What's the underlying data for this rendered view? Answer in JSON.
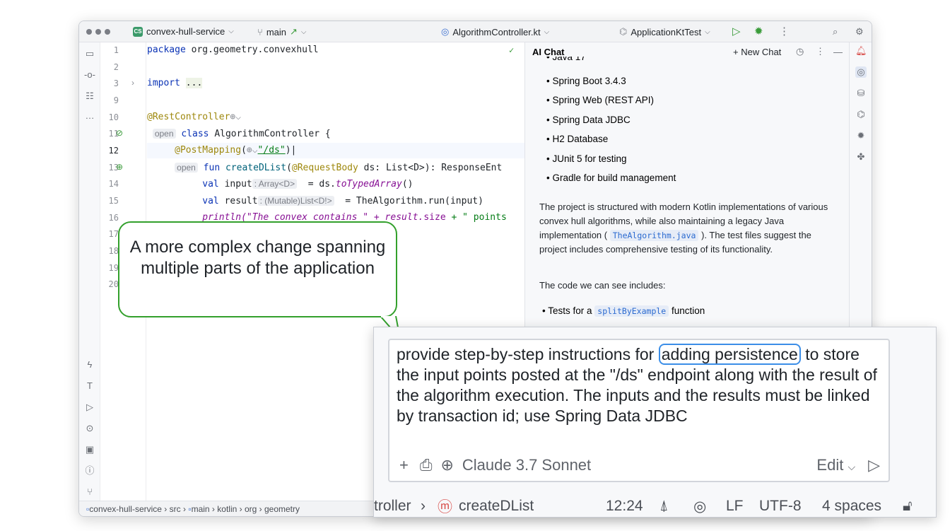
{
  "titlebar": {
    "project": "convex-hull-service",
    "branch": "main",
    "file": "AlgorithmController.kt",
    "run_config": "ApplicationKtTest"
  },
  "editor": {
    "line_numbers": [
      "1",
      "2",
      "3",
      "9",
      "10",
      "11",
      "12",
      "13",
      "14",
      "15",
      "16",
      "17",
      "18",
      "19",
      "20"
    ],
    "package_kw": "package",
    "package_name": "org.geometry.convexhull",
    "import_kw": "import",
    "import_fold": "...",
    "rest_controller": "@RestController",
    "open_hint": "open",
    "class_kw": "class",
    "class_name": "AlgorithmController {",
    "post_mapping": "@PostMapping",
    "post_mapping_path": "\"/ds\"",
    "fun_kw": "fun",
    "fun_name": "createDList",
    "request_body": "@RequestBody",
    "fun_params": "ds: List<D>): ResponseEnt",
    "val_kw": "val",
    "input_var": "input",
    "input_hint": ": Array<D>",
    "input_rhs": "= ds.",
    "to_typed_array": "toTypedArray",
    "parens": "()",
    "result_var": "result",
    "result_hint": ": (Mutable)List<D!>",
    "result_rhs": "= TheAlgorithm.run(input)",
    "println_line": "println(\"The convex contains \" + result.",
    "size_prop": "size",
    "println_tail": "+ \" points"
  },
  "chat": {
    "title": "AI Chat",
    "new_chat": "New Chat",
    "partial_bullet": "Java 17",
    "bullets": [
      "Spring Boot 3.4.3",
      "Spring Web (REST API)",
      "Spring Data JDBC",
      "H2 Database",
      "JUnit 5 for testing",
      "Gradle for build management"
    ],
    "para1_a": "The project is structured with modern Kotlin implementations of various convex hull algorithms, while also maintaining a legacy Java implementation (",
    "para1_code": "TheAlgorithm.java",
    "para1_b": "). The test files suggest the project includes comprehensive testing of its functionality.",
    "para2": "The code we can see includes:",
    "tests_a": "Tests for a",
    "tests_code": "splitByExample",
    "tests_b": "function"
  },
  "callout": {
    "text": "A more complex change spanning multiple parts of the application"
  },
  "prompt": {
    "text_a": "provide step-by-step instructions for",
    "highlight": "adding persistence",
    "text_b": "to store the input points posted at the \"/ds\" endpoint along with the result of the algorithm execution. The inputs and the results must be linked by transaction id; use Spring Data JDBC",
    "model": "Claude 3.7 Sonnet",
    "mode": "Edit"
  },
  "status": {
    "breadcrumb": [
      "convex-hull-service",
      "src",
      "main",
      "kotlin",
      "org",
      "geometry"
    ],
    "zoom_crumb": "troller",
    "zoom_fun": "createDList",
    "position": "12:24",
    "line_ending": "LF",
    "encoding": "UTF-8",
    "indent": "4 spaces"
  },
  "colors": {
    "accent_green": "#33a02c",
    "highlight_blue": "#3b8ee8"
  }
}
